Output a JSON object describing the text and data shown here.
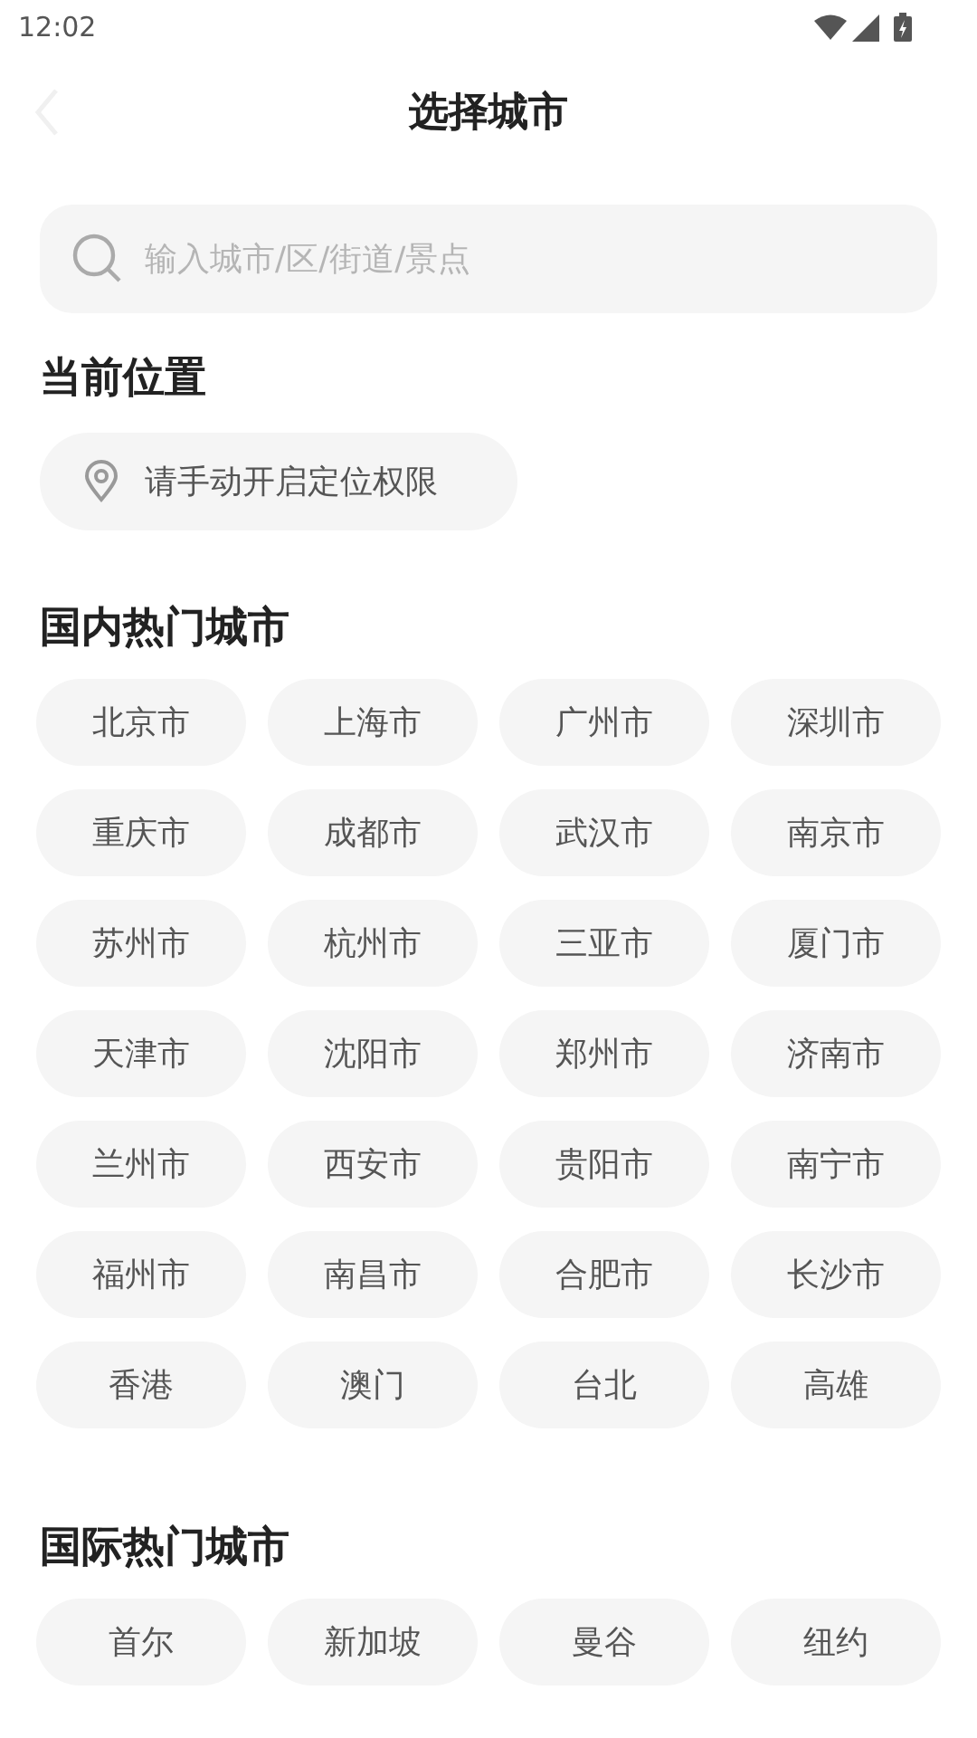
{
  "status_bar": {
    "time": "12:02"
  },
  "header": {
    "title": "选择城市"
  },
  "search": {
    "placeholder": "输入城市/区/街道/景点"
  },
  "current_location": {
    "heading": "当前位置",
    "button": "请手动开启定位权限"
  },
  "sections": [
    {
      "heading": "国内热门城市",
      "cities": [
        "北京市",
        "上海市",
        "广州市",
        "深圳市",
        "重庆市",
        "成都市",
        "武汉市",
        "南京市",
        "苏州市",
        "杭州市",
        "三亚市",
        "厦门市",
        "天津市",
        "沈阳市",
        "郑州市",
        "济南市",
        "兰州市",
        "西安市",
        "贵阳市",
        "南宁市",
        "福州市",
        "南昌市",
        "合肥市",
        "长沙市",
        "香港",
        "澳门",
        "台北",
        "高雄"
      ]
    },
    {
      "heading": "国际热门城市",
      "cities": [
        "首尔",
        "新加坡",
        "曼谷",
        "纽约"
      ]
    }
  ]
}
